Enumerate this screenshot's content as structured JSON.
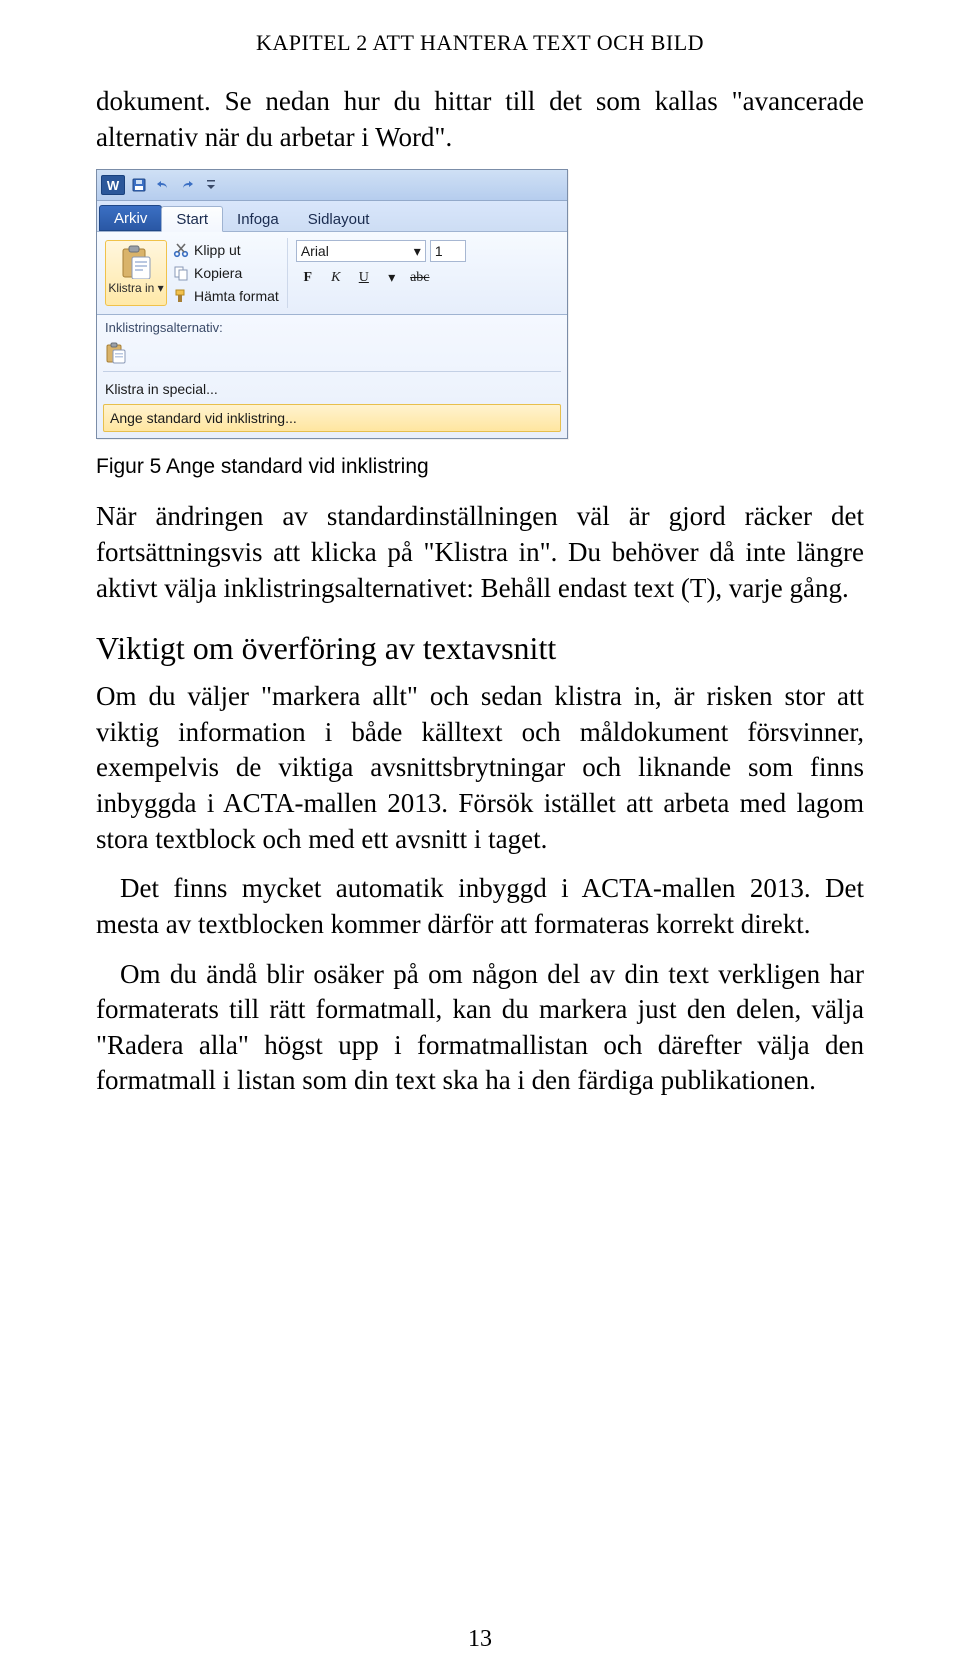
{
  "running_head": "KAPITEL 2 ATT HANTERA TEXT OCH BILD",
  "para1": "dokument. Se nedan hur du hittar till det som kallas \"avancerade alternativ när du arbetar i Word\".",
  "caption": "Figur 5 Ange standard vid inklistring",
  "para2": "När ändringen av standardinställningen väl är gjord räcker det fortsättningsvis att klicka på \"Klistra in\". Du behöver då inte längre aktivt välja inklistringsalternativet: Behåll endast text (T), varje gång.",
  "subhead": "Viktigt om överföring av textavsnitt",
  "para3": "Om du väljer \"markera allt\" och sedan klistra in, är risken stor att viktig information i både källtext och måldokument försvinner, exempelvis de viktiga avsnittsbrytningar och liknande som finns inbyggda i ACTA-mallen 2013. Försök istället att arbeta med lagom stora textblock och med ett avsnitt i taget.",
  "para4": "Det finns mycket automatik inbyggd i ACTA-mallen 2013. Det mesta av textblocken kommer därför att formateras korrekt direkt.",
  "para5": "Om du ändå blir osäker på om någon del av din text verkligen har formaterats till rätt formatmall, kan du markera just den delen, välja \"Radera alla\" högst upp i formatmallistan och därefter välja den formatmall i listan som din text ska ha i den färdiga publikationen.",
  "page_number": "13",
  "word": {
    "logo_letter": "W",
    "tabs": {
      "arkiv": "Arkiv",
      "start": "Start",
      "infoga": "Infoga",
      "sidlayout": "Sidlayout"
    },
    "paste_label": "Klistra in ▾",
    "clipboard": {
      "cut": "Klipp ut",
      "copy": "Kopiera",
      "format_painter": "Hämta format"
    },
    "font": {
      "name": "Arial",
      "size": "1",
      "bold": "F",
      "italic": "K",
      "underline": "U",
      "strike": "abc"
    },
    "dropdown": {
      "header": "Inklistringsalternativ:",
      "special": "Klistra in special...",
      "default": "Ange standard vid inklistring..."
    }
  }
}
